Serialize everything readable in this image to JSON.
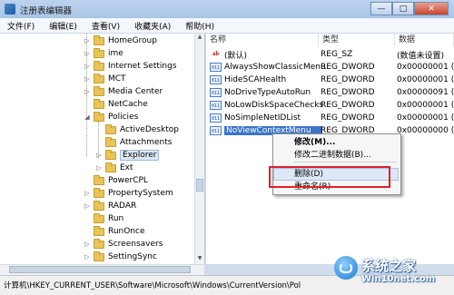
{
  "window": {
    "title": "注册表编辑器",
    "buttons": {
      "minimize": "—",
      "maximize": "□",
      "close": "✕"
    }
  },
  "menubar": [
    "文件(F)",
    "编辑(E)",
    "查看(V)",
    "收藏夹(A)",
    "帮助(H)"
  ],
  "tree": {
    "items": [
      {
        "label": "HomeGroup",
        "expander": "▷"
      },
      {
        "label": "ime",
        "expander": "▷"
      },
      {
        "label": "Internet Settings",
        "expander": "▷"
      },
      {
        "label": "MCT",
        "expander": "▷"
      },
      {
        "label": "Media Center",
        "expander": "▷"
      },
      {
        "label": "NetCache",
        "expander": ""
      },
      {
        "label": "Policies",
        "expander": "◢"
      },
      {
        "label": "ActiveDesktop",
        "expander": ""
      },
      {
        "label": "Attachments",
        "expander": ""
      },
      {
        "label": "Explorer",
        "expander": "▷"
      },
      {
        "label": "Ext",
        "expander": "▷"
      },
      {
        "label": "PowerCPL",
        "expander": ""
      },
      {
        "label": "PropertySystem",
        "expander": "▷"
      },
      {
        "label": "RADAR",
        "expander": "▷"
      },
      {
        "label": "Run",
        "expander": ""
      },
      {
        "label": "RunOnce",
        "expander": ""
      },
      {
        "label": "Screensavers",
        "expander": "▷"
      },
      {
        "label": "SettingSync",
        "expander": "▷"
      }
    ]
  },
  "values": {
    "headers": {
      "name": "名称",
      "type": "类型",
      "data": "数据"
    },
    "rows": [
      {
        "icon": "ab",
        "name": "(默认)",
        "type": "REG_SZ",
        "data": "(数值未设置)"
      },
      {
        "icon": "011",
        "name": "AlwaysShowClassicMenu",
        "type": "REG_DWORD",
        "data": "0x00000001 (1)"
      },
      {
        "icon": "011",
        "name": "HideSCAHealth",
        "type": "REG_DWORD",
        "data": "0x00000001 (1)"
      },
      {
        "icon": "011",
        "name": "NoDriveTypeAutoRun",
        "type": "REG_DWORD",
        "data": "0x00000091 (1"
      },
      {
        "icon": "011",
        "name": "NoLowDiskSpaceChecks",
        "type": "REG_DWORD",
        "data": "0x00000001 (1)"
      },
      {
        "icon": "011",
        "name": "NoSimpleNetIDList",
        "type": "REG_DWORD",
        "data": "0x00000001 (1)"
      },
      {
        "icon": "011",
        "name": "NoViewContextMenu",
        "type": "REG_DWORD",
        "data": "0x00000000 (0)"
      }
    ]
  },
  "context_menu": {
    "items": [
      "修改(M)...",
      "修改二进制数据(B)...",
      "删除(D)",
      "重命名(R)"
    ]
  },
  "statusbar": {
    "path": "计算机\\HKEY_CURRENT_USER\\Software\\Microsoft\\Windows\\CurrentVersion\\Pol"
  },
  "watermark": {
    "title": "系统之家",
    "url": "Win10net.com"
  },
  "colors": {
    "selection": "#3b74c7",
    "highlight_box": "#e0202a",
    "folder": "#e8c45a"
  }
}
